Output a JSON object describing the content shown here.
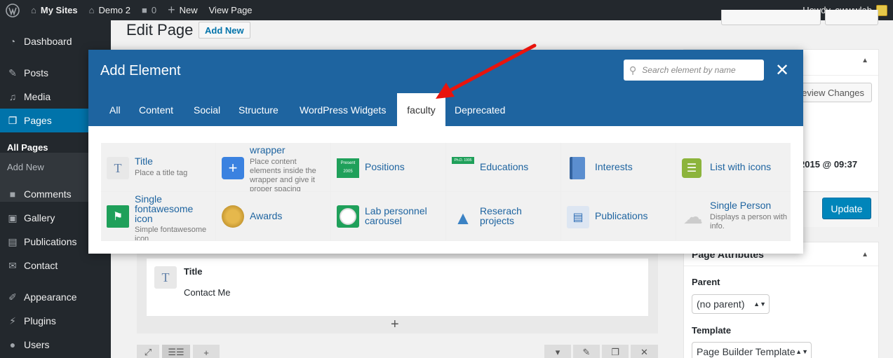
{
  "adminbar": {
    "my_sites": "My Sites",
    "site": "Demo 2",
    "comments": "0",
    "new": "New",
    "view_page": "View Page",
    "howdy": "Howdy, owwwlab"
  },
  "sidebar": {
    "items": [
      {
        "label": "Dashboard",
        "icon": "dashboard-icon"
      },
      {
        "label": "Posts",
        "icon": "pin-icon"
      },
      {
        "label": "Media",
        "icon": "media-icon"
      },
      {
        "label": "Pages",
        "icon": "pages-icon"
      },
      {
        "label": "Comments",
        "icon": "comment-icon"
      },
      {
        "label": "Gallery",
        "icon": "gallery-icon"
      },
      {
        "label": "Publications",
        "icon": "publications-icon"
      },
      {
        "label": "Contact",
        "icon": "mail-icon"
      },
      {
        "label": "Appearance",
        "icon": "brush-icon"
      },
      {
        "label": "Plugins",
        "icon": "plugin-icon"
      },
      {
        "label": "Users",
        "icon": "user-icon"
      }
    ],
    "sub": [
      "All Pages",
      "Add New"
    ]
  },
  "page": {
    "title": "Edit Page",
    "add_new": "Add New"
  },
  "publish": {
    "review_changes": "eview Changes",
    "date": "2015 @ 09:37",
    "update": "Update"
  },
  "attributes": {
    "title": "Page Attributes",
    "parent_label": "Parent",
    "parent_value": "(no parent)",
    "template_label": "Template",
    "template_value": "Page Builder Template"
  },
  "builder": {
    "element_title": "Title",
    "element_content": "Contact Me"
  },
  "modal": {
    "title": "Add Element",
    "search_placeholder": "Search element by name",
    "tabs": [
      "All",
      "Content",
      "Social",
      "Structure",
      "WordPress Widgets",
      "faculty",
      "Deprecated"
    ],
    "active_tab": "faculty",
    "elements": [
      {
        "name": "Title",
        "desc": "Place a title tag",
        "icon": "title-icon"
      },
      {
        "name": "wrapper",
        "desc": "Place content elements inside the wrapper and give it proper spacing",
        "icon": "plus-icon"
      },
      {
        "name": "Positions",
        "icon": "positions-icon",
        "icon_text": "Present 2005"
      },
      {
        "name": "Educations",
        "icon": "educations-icon",
        "icon_text": "Ph.D. 1995"
      },
      {
        "name": "Interests",
        "icon": "book-icon"
      },
      {
        "name": "List with icons",
        "icon": "list-icon"
      },
      {
        "name": "Single fontawesome icon",
        "desc": "Simple fontawesome icon",
        "icon": "flag-icon"
      },
      {
        "name": "Awards",
        "icon": "medal-icon"
      },
      {
        "name": "Lab personnel carousel",
        "icon": "person-icon"
      },
      {
        "name": "Reserach projects",
        "icon": "projects-icon"
      },
      {
        "name": "Publications",
        "icon": "publications-icon"
      },
      {
        "name": "Single Person",
        "desc": "Displays a person with info.",
        "icon": "cloud-icon"
      }
    ]
  },
  "colors": {
    "modal_header": "#1e64a0",
    "admin_bar": "#23282d",
    "active_menu": "#0073aa",
    "arrow": "#e8140d"
  }
}
